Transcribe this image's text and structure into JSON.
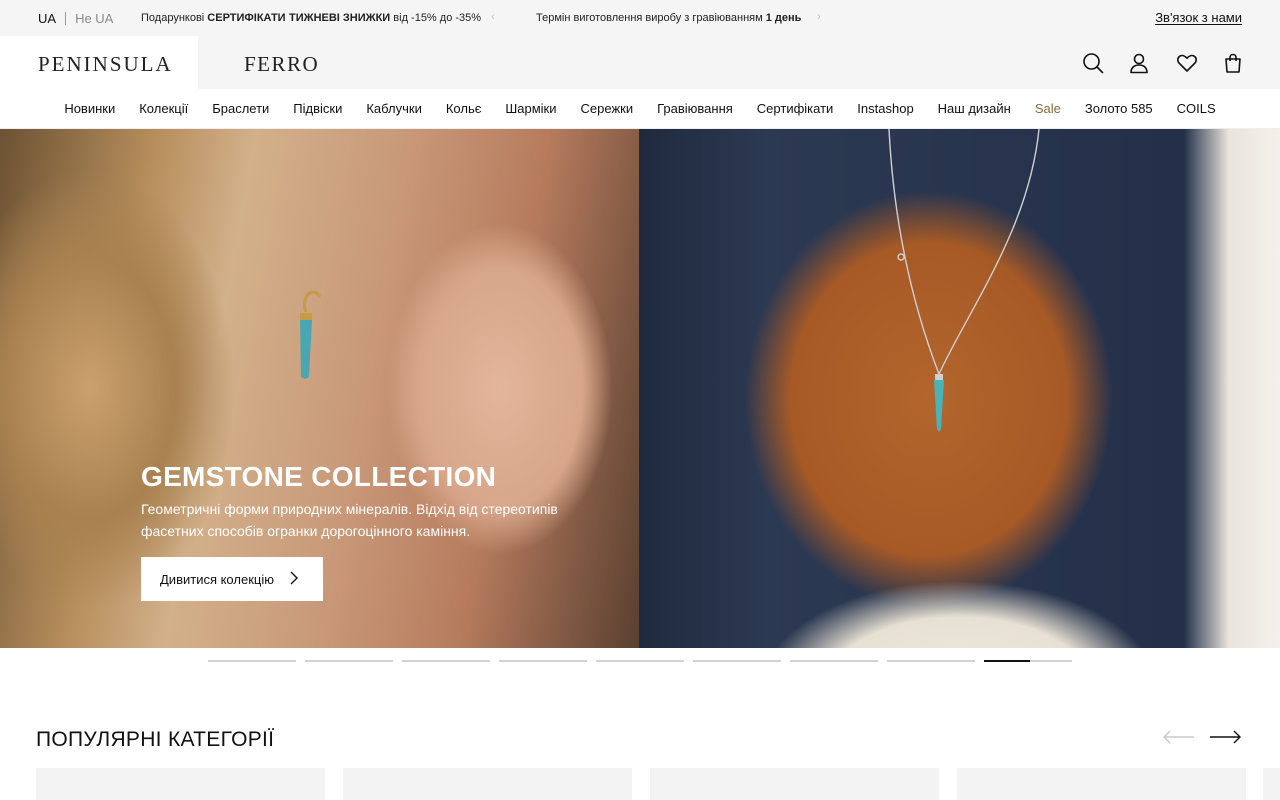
{
  "topbar": {
    "lang_active": "UA",
    "lang_inactive": "Не UA",
    "promo1": {
      "prefix": "Подарункові ",
      "bold": "СЕРТИФІКАТИ"
    },
    "promo2": {
      "bold": "ТИЖНЕВІ ЗНИЖКИ",
      "suffix": " від -15% до -35%"
    },
    "promo3": {
      "prefix": "Термін виготовлення виробу з гравіюванням ",
      "bold": "1 день"
    },
    "prev_icon": "chevron-left-icon",
    "next_icon": "chevron-right-icon",
    "contact": "Зв'язок з нами"
  },
  "header": {
    "brand_primary": "PENINSULA",
    "brand_secondary": "FERRO",
    "icons": [
      "search-icon",
      "user-icon",
      "heart-icon",
      "bag-icon"
    ]
  },
  "nav": {
    "items": [
      "Новинки",
      "Колекції",
      "Браслети",
      "Підвіски",
      "Каблучки",
      "Кольє",
      "Шарміки",
      "Сережки",
      "Гравіювання",
      "Сертифікати",
      "Instashop",
      "Наш дизайн",
      "Sale",
      "Золото 585",
      "COILS"
    ],
    "sale_color": "#8a6a3f"
  },
  "hero": {
    "title": "GEMSTONE COLLECTION",
    "description": "Геометричні форми природних мінералів. Відхід від стереотипів фасетних способів огранки дорогоцінного каміння.",
    "cta": "Дивитися колекцію",
    "slides_total": 9,
    "active_slide": 9
  },
  "categories": {
    "title": "ПОПУЛЯРНІ КАТЕГОРІЇ",
    "prev_icon": "arrow-left-icon",
    "next_icon": "arrow-right-icon"
  }
}
